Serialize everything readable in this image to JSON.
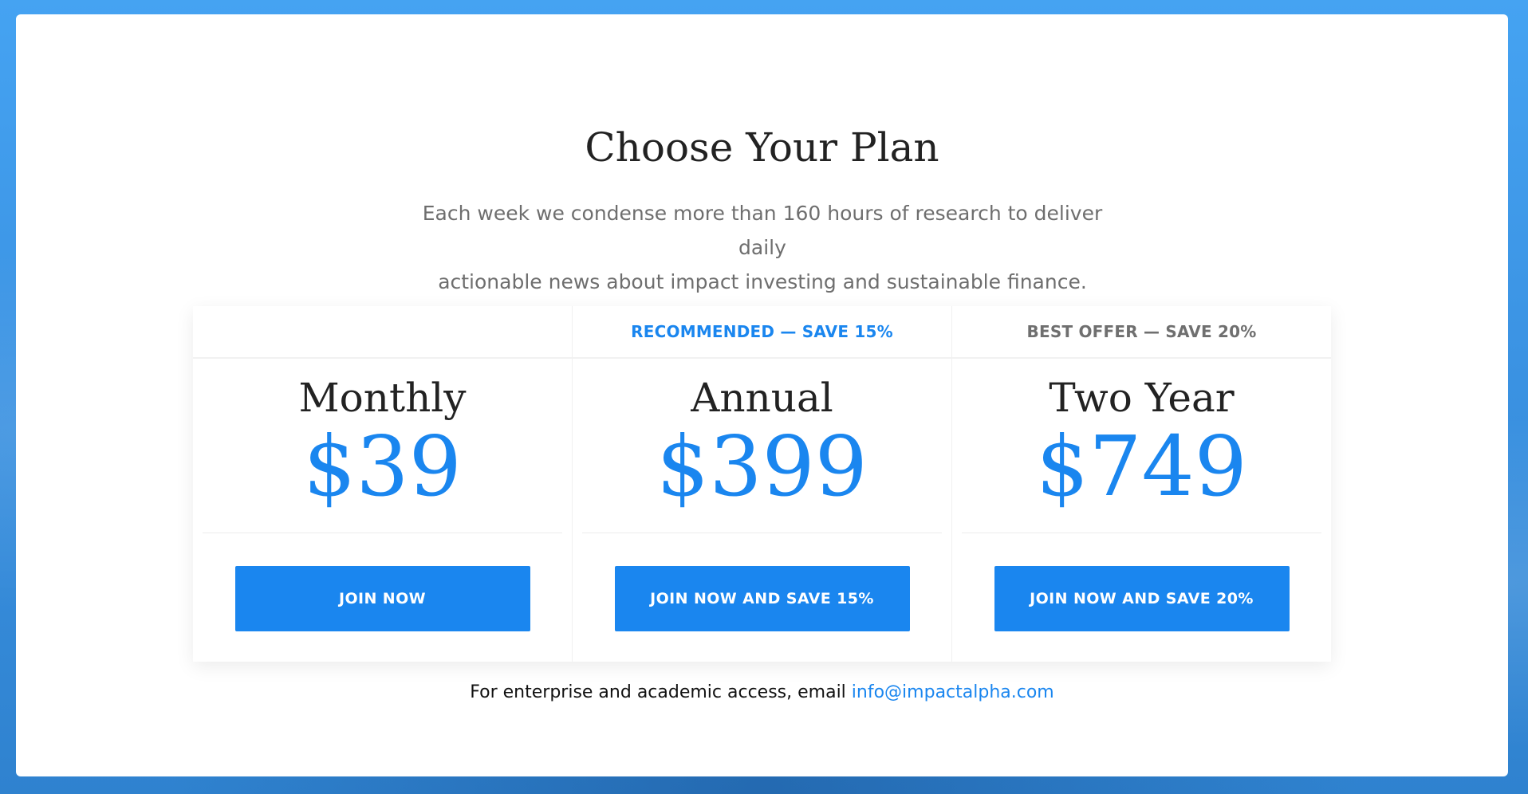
{
  "header": {
    "title": "Choose Your Plan",
    "subtitle_line1": "Each week we condense more than 160 hours of research to deliver daily",
    "subtitle_line2": "actionable news about impact investing and sustainable finance."
  },
  "plans": [
    {
      "badge": "",
      "name": "Monthly",
      "price": "$39",
      "button_label": "JOIN NOW"
    },
    {
      "badge": "RECOMMENDED — SAVE 15%",
      "name": "Annual",
      "price": "$399",
      "button_label": "JOIN NOW AND SAVE 15%"
    },
    {
      "badge": "BEST OFFER — SAVE 20%",
      "name": "Two Year",
      "price": "$749",
      "button_label": "JOIN NOW AND SAVE 20%"
    }
  ],
  "footer": {
    "text": "For enterprise and academic access, email ",
    "email": "info@impactalpha.com"
  },
  "colors": {
    "accent": "#1a86ef",
    "badge_gray": "#6f6f6f",
    "background": "#45a3f2"
  }
}
